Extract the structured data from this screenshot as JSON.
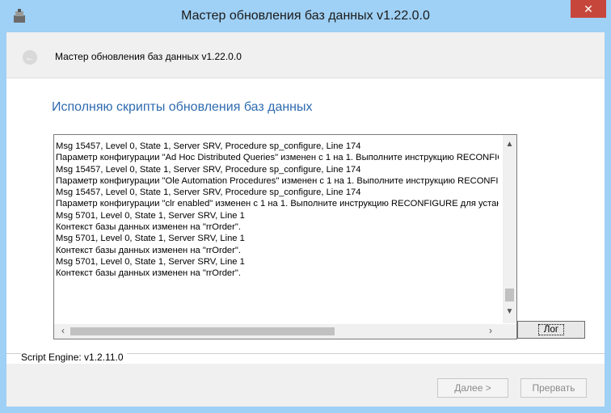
{
  "window": {
    "title": "Мастер обновления баз данных v1.22.0.0",
    "close_symbol": "✕"
  },
  "header": {
    "title": "Мастер обновления баз данных v1.22.0.0",
    "back_symbol": "←"
  },
  "page": {
    "heading": "Исполняю скрипты обновления баз данных"
  },
  "log": {
    "lines": [
      "Msg 15457, Level 0, State 1, Server SRV, Procedure sp_configure, Line 174",
      "Параметр конфигурации \"Ad Hoc Distributed Queries\" изменен с 1 на 1. Выполните инструкцию RECONFIGURE для установки.",
      "Msg 15457, Level 0, State 1, Server SRV, Procedure sp_configure, Line 174",
      "Параметр конфигурации \"Ole Automation Procedures\" изменен с 1 на 1. Выполните инструкцию RECONFIGURE для установки.",
      "Msg 15457, Level 0, State 1, Server SRV, Procedure sp_configure, Line 174",
      "Параметр конфигурации \"clr enabled\" изменен с 1 на 1. Выполните инструкцию RECONFIGURE для установки.",
      "Msg 5701, Level 0, State 1, Server SRV, Line 1",
      "Контекст базы данных изменен на \"rrOrder\".",
      "Msg 5701, Level 0, State 1, Server SRV, Line 1",
      "Контекст базы данных изменен на \"rrOrder\".",
      "Msg 5701, Level 0, State 1, Server SRV, Line 1",
      "Контекст базы данных изменен на \"rrOrder\"."
    ],
    "button_label": "Лог"
  },
  "footer": {
    "engine_text": "Script Engine: v1.2.11.0",
    "next_label": "Далее >",
    "cancel_label": "Прервать"
  }
}
